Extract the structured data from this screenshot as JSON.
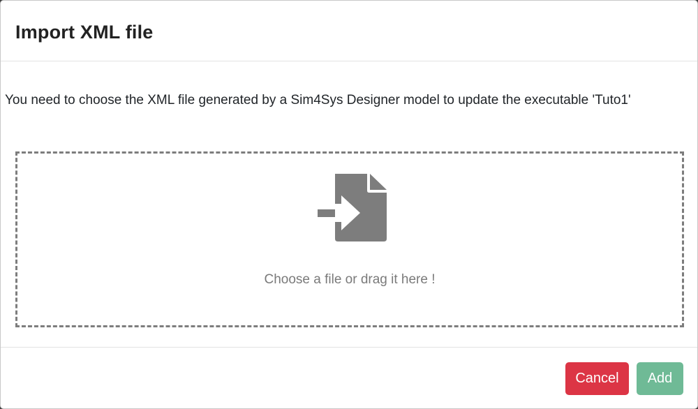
{
  "dialog": {
    "title": "Import XML file",
    "description": "You need to choose the XML file generated by a Sim4Sys Designer model to update the executable 'Tuto1'"
  },
  "dropzone": {
    "icon": "file-import-icon",
    "text": "Choose a file or drag it here !"
  },
  "footer": {
    "cancel_label": "Cancel",
    "add_label": "Add"
  },
  "colors": {
    "cancel": "#dc3545",
    "add": "#6fba96",
    "icon": "#7d7d7d"
  }
}
